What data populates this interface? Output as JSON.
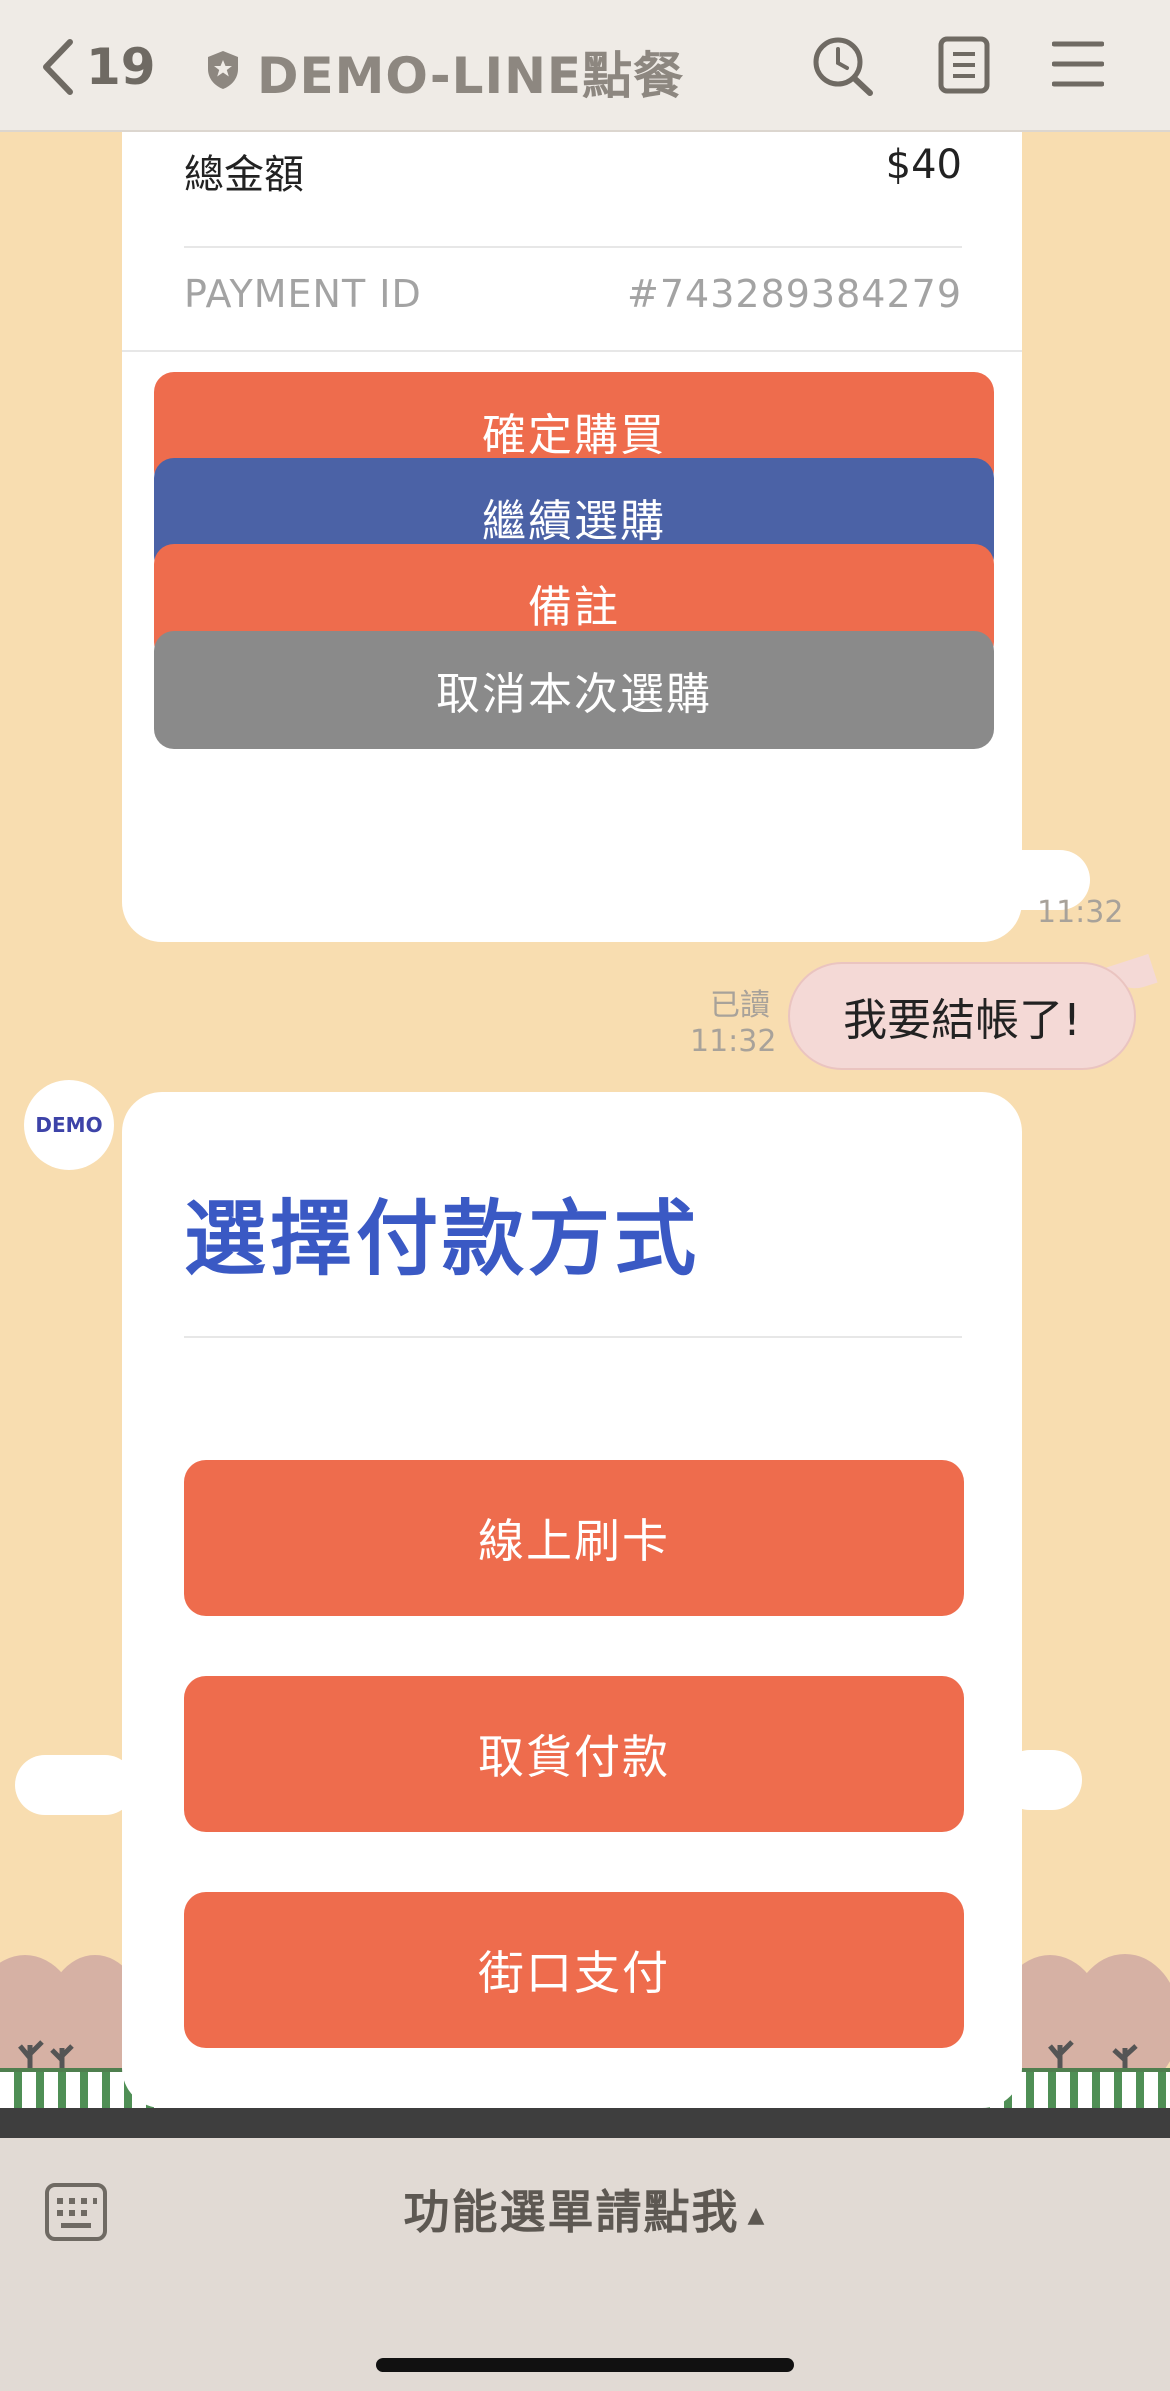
{
  "header": {
    "back_count": "19",
    "title": "DEMO-LINE點餐",
    "icons": [
      "back-chevron-icon",
      "shield-icon",
      "search-history-icon",
      "note-icon",
      "menu-icon"
    ]
  },
  "order_card": {
    "total_label": "總金額",
    "total_value": "$40",
    "payment_id_label": "PAYMENT ID",
    "payment_id_value": "#743289384279",
    "buttons": [
      {
        "label": "確定購買",
        "color": "#ee6c4d"
      },
      {
        "label": "繼續選購",
        "color": "#4b62a6"
      },
      {
        "label": "備註",
        "color": "#ee6c4d"
      },
      {
        "label": "取消本次選購",
        "color": "#8a8a8a"
      }
    ],
    "time": "11:32"
  },
  "my_message": {
    "read_label": "已讀",
    "time": "11:32",
    "text": "我要結帳了!"
  },
  "avatar": {
    "text": "DEMO"
  },
  "payment_card": {
    "title": "選擇付款方式",
    "options": [
      {
        "label": "線上刷卡"
      },
      {
        "label": "取貨付款"
      },
      {
        "label": "街口支付"
      }
    ],
    "accent_color": "#3a59c4",
    "button_color": "#ee6c4d"
  },
  "bottom_bar": {
    "menu_label": "功能選單請點我",
    "arrow": "▲"
  }
}
